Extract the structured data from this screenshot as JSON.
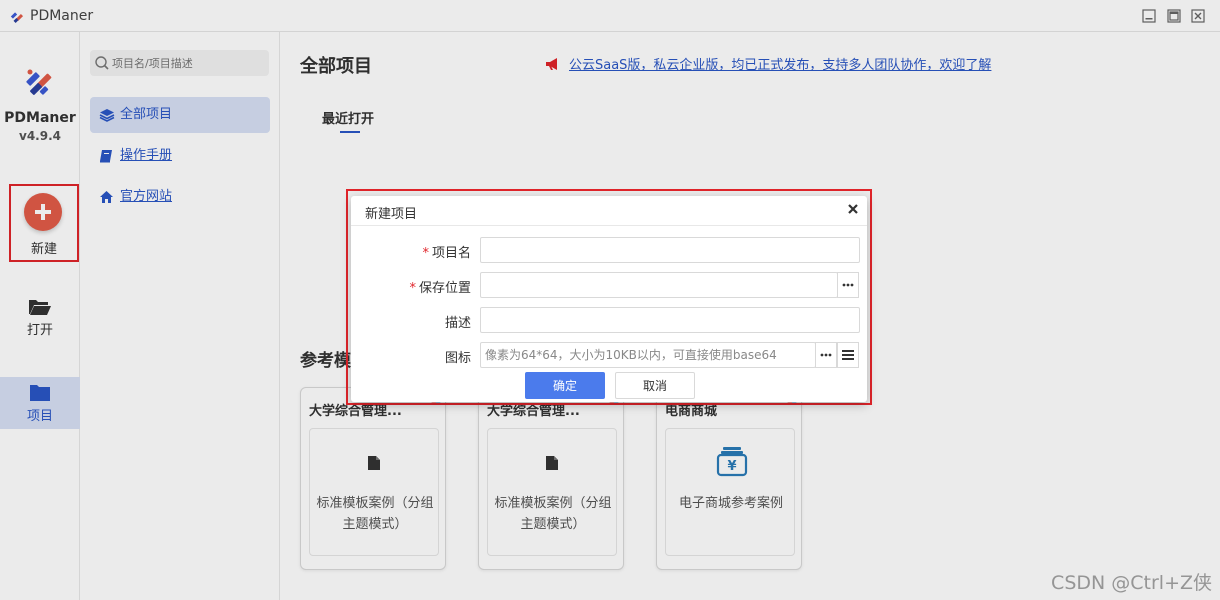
{
  "window": {
    "title": "PDManer"
  },
  "rail": {
    "brand_name": "PDManer",
    "version": "v4.9.4",
    "new_label": "新建",
    "open_label": "打开",
    "project_label": "项目"
  },
  "nav": {
    "search_placeholder": "项目名/项目描述",
    "items": [
      {
        "label": "全部项目",
        "icon": "layers-icon"
      },
      {
        "label": "操作手册",
        "icon": "book-icon"
      },
      {
        "label": "官方网站",
        "icon": "home-icon"
      }
    ]
  },
  "main": {
    "title": "全部项目",
    "announcement": "公云SaaS版，私云企业版，均已正式发布，支持多人团队协作，欢迎了解",
    "recent_tab": "最近打开",
    "reference_title": "参考模板",
    "cards": [
      {
        "title": "大学综合管理...",
        "desc": "标准模板案例（分组主题模式）",
        "icon": "file-icon"
      },
      {
        "title": "大学综合管理...",
        "desc": "标准模板案例（分组主题模式）",
        "icon": "file-icon"
      },
      {
        "title": "电商商城",
        "desc": "电子商城参考案例",
        "icon": "cash-register-icon"
      }
    ]
  },
  "modal": {
    "title": "新建项目",
    "fields": {
      "name_label": "项目名",
      "location_label": "保存位置",
      "desc_label": "描述",
      "icon_label": "图标",
      "icon_placeholder": "像素为64*64，大小为10KB以内，可直接使用base64"
    },
    "ok_label": "确定",
    "cancel_label": "取消"
  },
  "watermark": "CSDN @Ctrl+Z侠",
  "colors": {
    "accent": "#2a56c6",
    "primary_button": "#4b7bec",
    "new_button": "#e25c48",
    "highlight_border": "#e0242a"
  }
}
